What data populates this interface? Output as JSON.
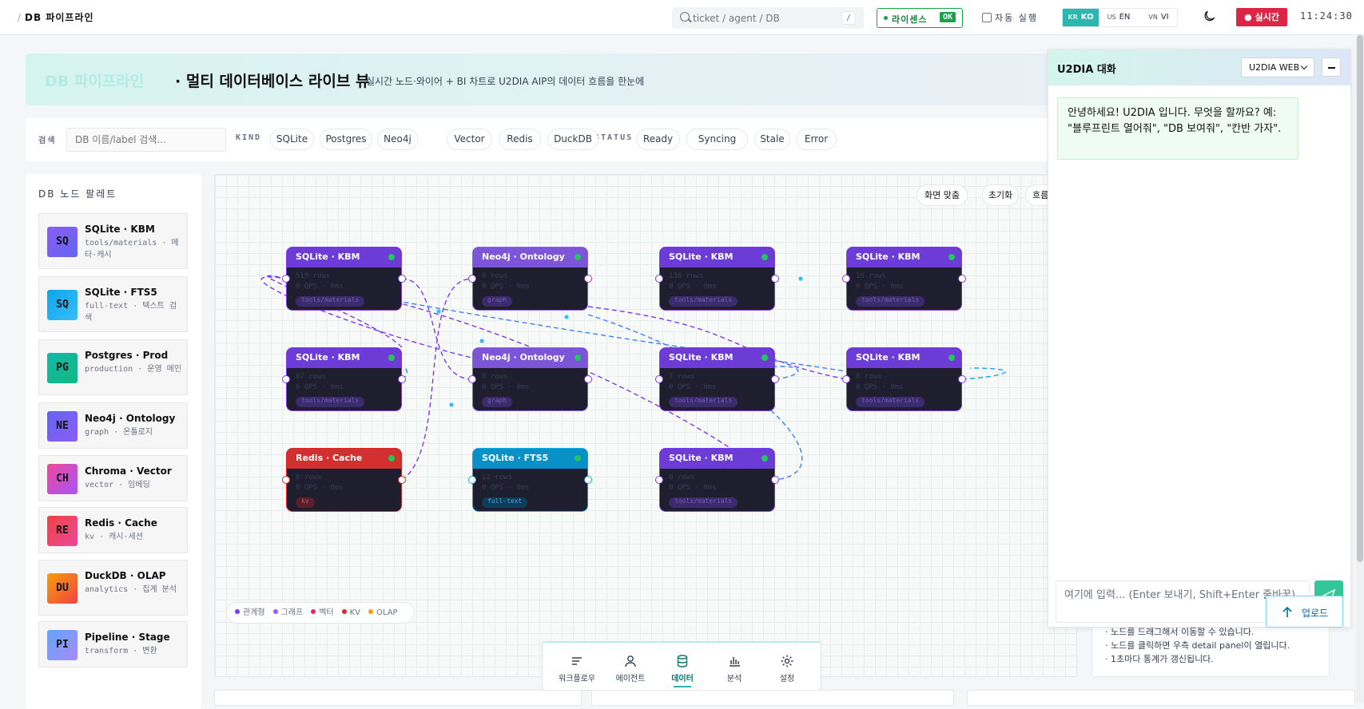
{
  "topbar": {
    "breadcrumb_sep": "/",
    "breadcrumb": "DB 파이프라인",
    "search_placeholder": "ticket / agent / DB",
    "search_shortcut": "/",
    "license_label": "라이센스",
    "license_status": "OK",
    "auto_exec_label": "자동 실행",
    "languages": [
      {
        "flag": "KR",
        "code": "KO",
        "active": true
      },
      {
        "flag": "US",
        "code": "EN",
        "active": false
      },
      {
        "flag": "VN",
        "code": "VI",
        "active": false
      }
    ],
    "live_label": "실시간",
    "clock": "11:24:30"
  },
  "hero": {
    "title_accent": "DB 파이프라인",
    "title_main": "· 멀티 데이터베이스 라이브 뷰",
    "subtitle": "실시간 노드·와이어 + BI 차트로 U2DIA AIP의 데이터 흐름을 한눈에"
  },
  "filters": {
    "search_label": "검색",
    "search_placeholder": "DB 이름/label 검색...",
    "kind_label": "KIND",
    "kinds": [
      "SQLite",
      "Postgres",
      "Neo4j",
      "Vector",
      "Redis",
      "DuckDB"
    ],
    "status_label": "STATUS",
    "statuses": [
      "Ready",
      "Syncing",
      "Stale",
      "Error"
    ]
  },
  "palette": {
    "title": "DB 노드 팔레트",
    "items": [
      {
        "abbr": "SQ",
        "name": "SQLite · KBM",
        "desc": "tools/materials · 메타·캐시"
      },
      {
        "abbr": "SQ",
        "name": "SQLite · FTS5",
        "desc": "full-text · 텍스트 검색"
      },
      {
        "abbr": "PG",
        "name": "Postgres · Prod",
        "desc": "production · 운영 메인"
      },
      {
        "abbr": "NE",
        "name": "Neo4j · Ontology",
        "desc": "graph · 온톨로지"
      },
      {
        "abbr": "CH",
        "name": "Chroma · Vector",
        "desc": "vector · 임베딩"
      },
      {
        "abbr": "RE",
        "name": "Redis · Cache",
        "desc": "kv · 캐시·세션"
      },
      {
        "abbr": "DU",
        "name": "DuckDB · OLAP",
        "desc": "analytics · 집계 분석"
      },
      {
        "abbr": "PI",
        "name": "Pipeline · Stage",
        "desc": "transform · 변환"
      }
    ]
  },
  "canvas": {
    "buttons": [
      "화면 맞춤",
      "초기화",
      "흐름"
    ],
    "nodes": [
      {
        "title": "SQLite · KBM",
        "rows": "519 rows",
        "qps": "0 QPS · 0ms",
        "tag": "tools/materials",
        "kind": "sqlite"
      },
      {
        "title": "Neo4j · Ontology",
        "rows": "0 rows",
        "qps": "0 QPS · 0ms",
        "tag": "graph",
        "kind": "neo"
      },
      {
        "title": "SQLite · KBM",
        "rows": "136 rows",
        "qps": "0 QPS · 0ms",
        "tag": "tools/materials",
        "kind": "sqlite"
      },
      {
        "title": "SQLite · KBM",
        "rows": "16 rows",
        "qps": "0 QPS · 0ms",
        "tag": "tools/materials",
        "kind": "sqlite"
      },
      {
        "title": "SQLite · KBM",
        "rows": "87 rows",
        "qps": "0 QPS · 0ms",
        "tag": "tools/materials",
        "kind": "sqlite"
      },
      {
        "title": "Neo4j · Ontology",
        "rows": "0 rows",
        "qps": "0 QPS · 0ms",
        "tag": "graph",
        "kind": "neo"
      },
      {
        "title": "SQLite · KBM",
        "rows": "7 rows",
        "qps": "0 QPS · 0ms",
        "tag": "tools/materials",
        "kind": "sqlite"
      },
      {
        "title": "SQLite · KBM",
        "rows": "8 rows",
        "qps": "0 QPS · 0ms",
        "tag": "tools/materials",
        "kind": "sqlite"
      },
      {
        "title": "Redis · Cache",
        "rows": "0 rows",
        "qps": "0 QPS · 0ms",
        "tag": "kv",
        "kind": "redis"
      },
      {
        "title": "SQLite · FTS5",
        "rows": "12 rows",
        "qps": "0 QPS · 0ms",
        "tag": "full-text",
        "kind": "fts"
      },
      {
        "title": "SQLite · KBM",
        "rows": "0 rows",
        "qps": "0 QPS · 0ms",
        "tag": "tools/materials",
        "kind": "sqlite"
      }
    ],
    "legend": [
      {
        "label": "관계형",
        "color": "#7c3aed"
      },
      {
        "label": "그래프",
        "color": "#a855f7"
      },
      {
        "label": "벡터",
        "color": "#db2777"
      },
      {
        "label": "KV",
        "color": "#dc2626"
      },
      {
        "label": "OLAP",
        "color": "#f59e0b"
      }
    ]
  },
  "dock": [
    {
      "label": "워크플로우",
      "icon": "workflow-icon",
      "active": false
    },
    {
      "label": "에이전트",
      "icon": "agent-icon",
      "active": false
    },
    {
      "label": "데이터",
      "icon": "database-icon",
      "active": true
    },
    {
      "label": "분석",
      "icon": "chart-icon",
      "active": false
    },
    {
      "label": "설정",
      "icon": "gear-icon",
      "active": false
    }
  ],
  "hints": [
    "· 노드를 드래그해서 이동할 수 있습니다.",
    "· 노드를 클릭하면 우측 detail panel이 열립니다.",
    "· 1초마다 통계가 갱신됩니다."
  ],
  "chat": {
    "title": "U2DIA 대화",
    "selector": "U2DIA WEB",
    "welcome": "안녕하세요! U2DIA 입니다. 무엇을 할까요? 예: \"블루프린트 열어줘\", \"DB 보여줘\", \"칸반 가자\".",
    "input_placeholder": "여기에 입력... (Enter 보내기, Shift+Enter 줄바꿈)",
    "upload_label": "업로드"
  },
  "colors": {
    "accent": "#2ab7b0",
    "live": "#dc2646",
    "node_border": "#7c3aed"
  }
}
